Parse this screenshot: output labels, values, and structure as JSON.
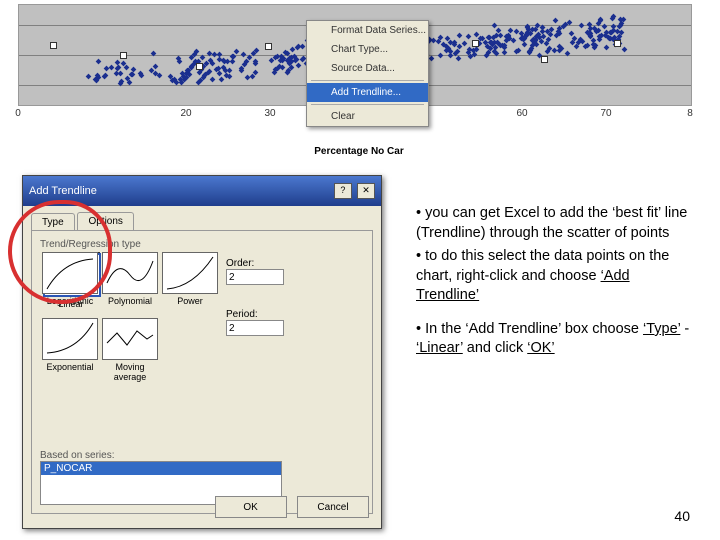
{
  "chart_data": {
    "type": "scatter",
    "xlabel": "Percentage No Car",
    "ylabel": "",
    "xticks": [
      "0",
      "20",
      "30",
      "",
      "",
      "60",
      "70",
      "8"
    ],
    "x_range": [
      0,
      80
    ],
    "y_range": [
      0,
      100
    ],
    "series": [
      {
        "name": "P_NOCAR",
        "values_note": "dense scatter cloud, ~400 pts, y increases with x, x roughly 5–75, y roughly 10–85"
      }
    ]
  },
  "context_menu": {
    "items": [
      "Format Data Series...",
      "Chart Type...",
      "Source Data...",
      "Add Trendline...",
      "Clear"
    ],
    "highlighted": 3
  },
  "dialog": {
    "title": "Add Trendline",
    "tabs": [
      "Type",
      "Options"
    ],
    "active_tab": 0,
    "group_label": "Trend/Regression type",
    "types": [
      "Linear",
      "Logarithmic",
      "Polynomial",
      "Power",
      "Exponential",
      "Moving average"
    ],
    "selected_type": 0,
    "order_label": "Order:",
    "order_value": "2",
    "period_label": "Period:",
    "period_value": "2",
    "series_label": "Based on series:",
    "series_items": [
      "P_NOCAR"
    ],
    "ok": "OK",
    "cancel": "Cancel",
    "help_btn": "?",
    "close_btn": "✕"
  },
  "notes": {
    "b1a": "• you can get Excel to add the ‘best fit’ line (Trendline) through the scatter of points",
    "b1b": "• to do this select the data points on the chart, right-click and choose ",
    "u1": "‘Add Trendline’",
    "b2a": "• In the ‘Add Trendline’ box choose ",
    "u2": "‘Type’",
    "dash": " - ",
    "u3": "‘Linear’",
    "and": " and click ",
    "u4": "‘OK’"
  },
  "page_number": "40"
}
